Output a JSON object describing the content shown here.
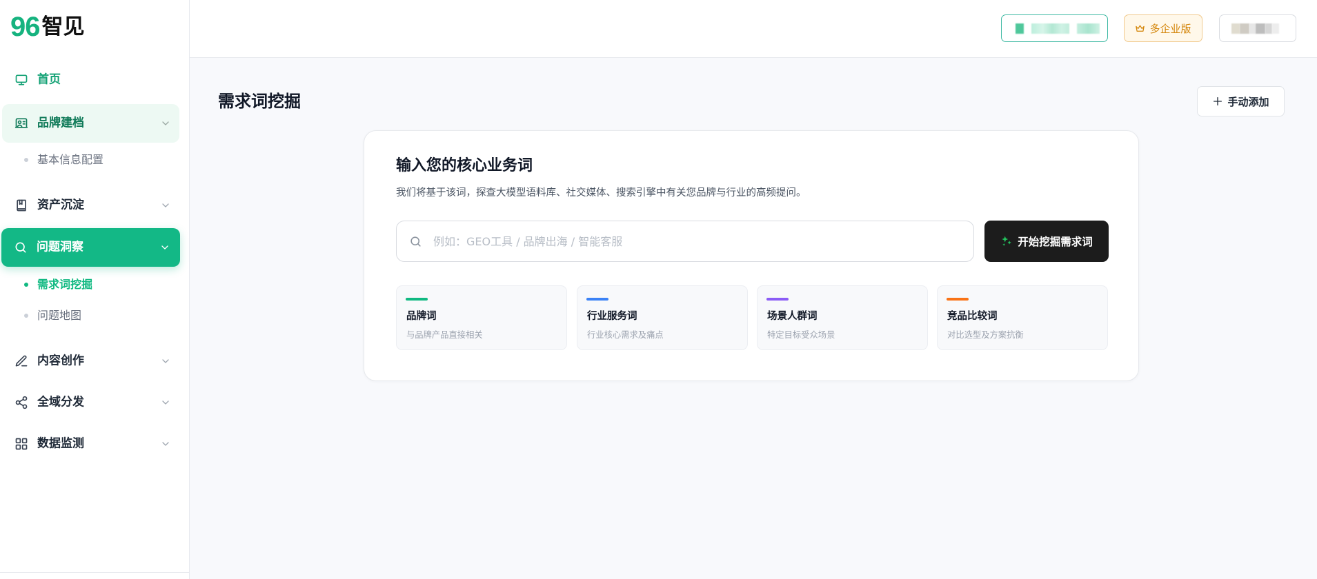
{
  "app": {
    "logo_mark": "96",
    "logo_name": "智见"
  },
  "sidebar": {
    "items": [
      {
        "label": "首页",
        "icon": "monitor-icon"
      },
      {
        "label": "品牌建档",
        "icon": "contact-card-icon",
        "expanded": true,
        "children": [
          {
            "label": "基本信息配置"
          }
        ]
      },
      {
        "label": "资产沉淀",
        "icon": "book-icon"
      },
      {
        "label": "问题洞察",
        "icon": "search-icon",
        "active": true,
        "expanded": true,
        "children": [
          {
            "label": "需求词挖掘",
            "active": true
          },
          {
            "label": "问题地图"
          }
        ]
      },
      {
        "label": "内容创作",
        "icon": "pen-icon"
      },
      {
        "label": "全域分发",
        "icon": "share-icon"
      },
      {
        "label": "数据监测",
        "icon": "grid-icon"
      }
    ]
  },
  "header": {
    "plan_badge": {
      "label": "多企业版",
      "icon": "crown-icon"
    }
  },
  "page": {
    "title": "需求词挖掘",
    "add_button": {
      "label": "手动添加",
      "icon": "plus-icon"
    }
  },
  "miner": {
    "heading": "输入您的核心业务词",
    "description": "我们将基于该词，探查大模型语料库、社交媒体、搜索引擎中有关您品牌与行业的高频提问。",
    "search": {
      "value": "",
      "placeholder": "例如：GEO工具 / 品牌出海 / 智能客服",
      "icon": "search-icon"
    },
    "submit": {
      "label": "开始挖掘需求词",
      "icon": "sparkles-icon"
    },
    "categories": [
      {
        "title": "品牌词",
        "desc": "与品牌产品直接相关",
        "color": "#10b981"
      },
      {
        "title": "行业服务词",
        "desc": "行业核心需求及痛点",
        "color": "#3b82f6"
      },
      {
        "title": "场景人群词",
        "desc": "特定目标受众场景",
        "color": "#8b5cf6"
      },
      {
        "title": "竞品比较词",
        "desc": "对比选型及方案抗衡",
        "color": "#f97316"
      }
    ]
  },
  "colors": {
    "accent": "#10b981",
    "nav_active_bg": "#13b886",
    "submit_bg": "#1c1c1c",
    "plan_badge_text": "#d4860b"
  }
}
